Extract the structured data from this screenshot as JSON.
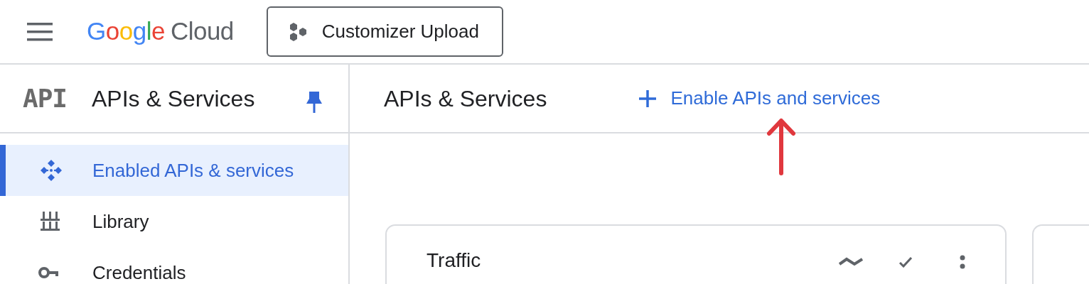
{
  "header": {
    "logo_google": "Google",
    "logo_cloud": "Cloud",
    "project_button": "Customizer Upload"
  },
  "sidebar": {
    "logo": "API",
    "title": "APIs & Services",
    "pinned": true,
    "items": [
      {
        "label": "Enabled APIs & services",
        "kind": "diamond",
        "selected": true
      },
      {
        "label": "Library",
        "kind": "library",
        "selected": false
      },
      {
        "label": "Credentials",
        "kind": "key",
        "selected": false
      }
    ]
  },
  "main": {
    "title": "APIs & Services",
    "action": "Enable APIs and services",
    "card": {
      "title": "Traffic"
    }
  }
}
